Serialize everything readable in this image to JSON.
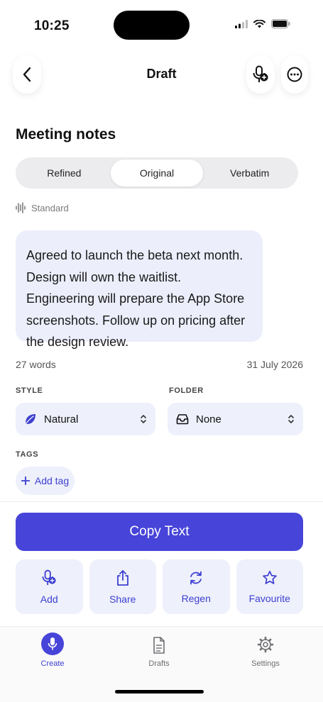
{
  "status_bar": {
    "time": "10:25"
  },
  "header": {
    "title": "Draft",
    "back_icon": "chevron-left-icon",
    "mic_icon": "mic-add-icon",
    "more_icon": "ellipsis-circle-icon"
  },
  "note": {
    "title": "Meeting notes",
    "tabs": [
      {
        "label": "Refined",
        "active": false
      },
      {
        "label": "Original",
        "active": true
      },
      {
        "label": "Verbatim",
        "active": false
      }
    ],
    "mode": "Standard",
    "transcript": "Agreed to launch the beta next month. Design will own the waitlist. Engineering will prepare the App Store screenshots. Follow up on pricing after the design review.",
    "word_count": "27 words",
    "date": "31 July 2026"
  },
  "style": {
    "label": "STYLE",
    "value": "Natural",
    "icon": "leaf-icon"
  },
  "folder": {
    "label": "FOLDER",
    "value": "None",
    "icon": "tray-icon"
  },
  "tags": {
    "label": "TAGS",
    "add_label": "Add tag"
  },
  "copy_button": "Copy Text",
  "actions": [
    {
      "label": "Add",
      "icon": "mic-add-icon"
    },
    {
      "label": "Share",
      "icon": "share-icon"
    },
    {
      "label": "Regen",
      "icon": "refresh-icon"
    },
    {
      "label": "Favourite",
      "icon": "star-icon"
    }
  ],
  "tabbar": [
    {
      "label": "Create",
      "active": true
    },
    {
      "label": "Drafts",
      "active": false
    },
    {
      "label": "Settings",
      "active": false
    }
  ],
  "colors": {
    "accent": "#4744d9",
    "tint": "#eef0fb",
    "segment_bg": "#ececef"
  }
}
